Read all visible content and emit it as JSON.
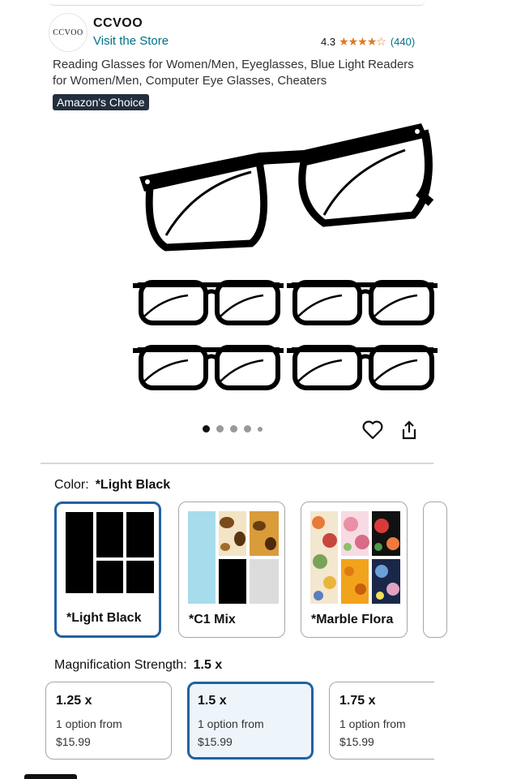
{
  "store": {
    "logo_text": "CCVOO",
    "brand": "CCVOO",
    "visit_label": "Visit the Store",
    "rating": "4.3",
    "review_count": "(440)"
  },
  "product": {
    "title": "Reading Glasses for Women/Men, Eyeglasses, Blue Light Readers for Women/Men, Computer Eye Glasses, Cheaters",
    "badge": "Amazon's Choice"
  },
  "gallery": {
    "dot_count": 5,
    "active_index": 0
  },
  "color": {
    "label": "Color:",
    "selected": "*Light Black",
    "options": [
      {
        "label": "*Light Black"
      },
      {
        "label": "*C1 Mix"
      },
      {
        "label": "*Marble Flora"
      }
    ]
  },
  "magnification": {
    "label": "Magnification Strength:",
    "selected": "1.5 x",
    "options": [
      {
        "value": "1.25 x",
        "note": "1 option from",
        "price": "$15.99"
      },
      {
        "value": "1.5 x",
        "note": "1 option from",
        "price": "$15.99"
      },
      {
        "value": "1.75 x",
        "note": "1 option from",
        "price": "$15.99"
      }
    ]
  },
  "colors": {
    "link": "#007185",
    "star": "#de7921",
    "badge_bg": "#232f3e",
    "selected_border": "#2162a1"
  }
}
